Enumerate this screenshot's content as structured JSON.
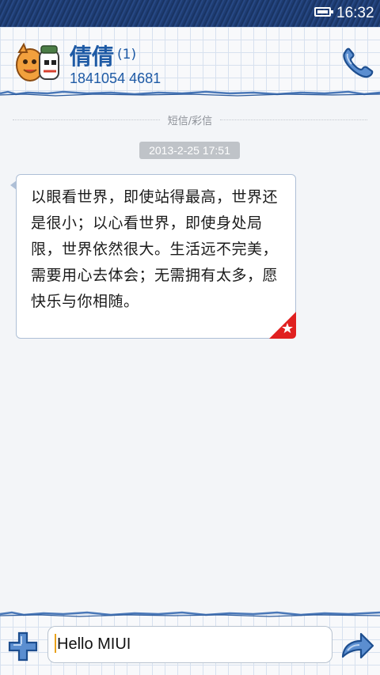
{
  "status_bar": {
    "time": "16:32",
    "icons": [
      "battery-icon"
    ]
  },
  "header": {
    "contact_name": "倩倩",
    "message_count": "(1)",
    "phone_number": "1841054 4681",
    "icons": [
      "avatar-icon",
      "phone-call-icon"
    ]
  },
  "thread": {
    "type_label": "短信/彩信",
    "timestamp": "2013-2-25 17:51",
    "messages": [
      {
        "text": "以眼看世界，即使站得最高，世界还是很小；以心看世界，即使身处局限，世界依然很大。生活远不完美，需要用心去体会；无需拥有太多，愿快乐与你相随。",
        "direction": "incoming",
        "starred": true
      }
    ]
  },
  "composer": {
    "value": "Hello MIUI",
    "icons": [
      "add-attachment-icon",
      "send-icon"
    ]
  },
  "colors": {
    "status_bar": "#1f3f78",
    "accent": "#1e5aa5",
    "bubble_border": "#aebfd6",
    "star_badge": "#e02020",
    "timestamp_bg": "#bfc3c8"
  }
}
